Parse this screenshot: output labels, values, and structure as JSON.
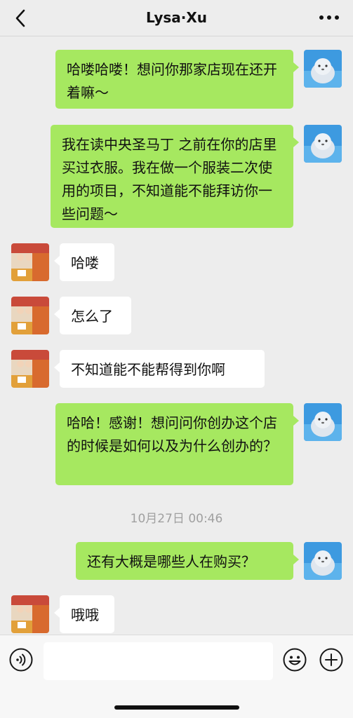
{
  "header": {
    "title": "Lysa·Xu",
    "back_icon": "chevron-left-icon",
    "more_icon": "ellipsis-icon"
  },
  "messages": [
    {
      "sender": "me",
      "text": "哈喽哈喽！想问你那家店现在还开着嘛～"
    },
    {
      "sender": "me",
      "text": "我在读中央圣马丁 之前在你的店里买过衣服。我在做一个服装二次使用的项目，不知道能不能拜访你一些问题～"
    },
    {
      "sender": "them",
      "text": "哈喽"
    },
    {
      "sender": "them",
      "text": "怎么了"
    },
    {
      "sender": "them",
      "text": "不知道能不能帮得到你啊"
    },
    {
      "sender": "me",
      "text": "哈哈！感谢！想问问你创办这个店的时候是如何以及为什么创办的？"
    },
    {
      "sender": "me",
      "text": "还有大概是哪些人在购买？"
    },
    {
      "sender": "them",
      "text": "哦哦"
    }
  ],
  "timestamp": "10月27日 00:46",
  "input_bar": {
    "value": "",
    "voice_icon": "voice-icon",
    "emoji_icon": "emoji-icon",
    "plus_icon": "plus-icon"
  },
  "colors": {
    "my_bubble": "#a6e860",
    "their_bubble": "#ffffff",
    "background": "#ededed"
  }
}
